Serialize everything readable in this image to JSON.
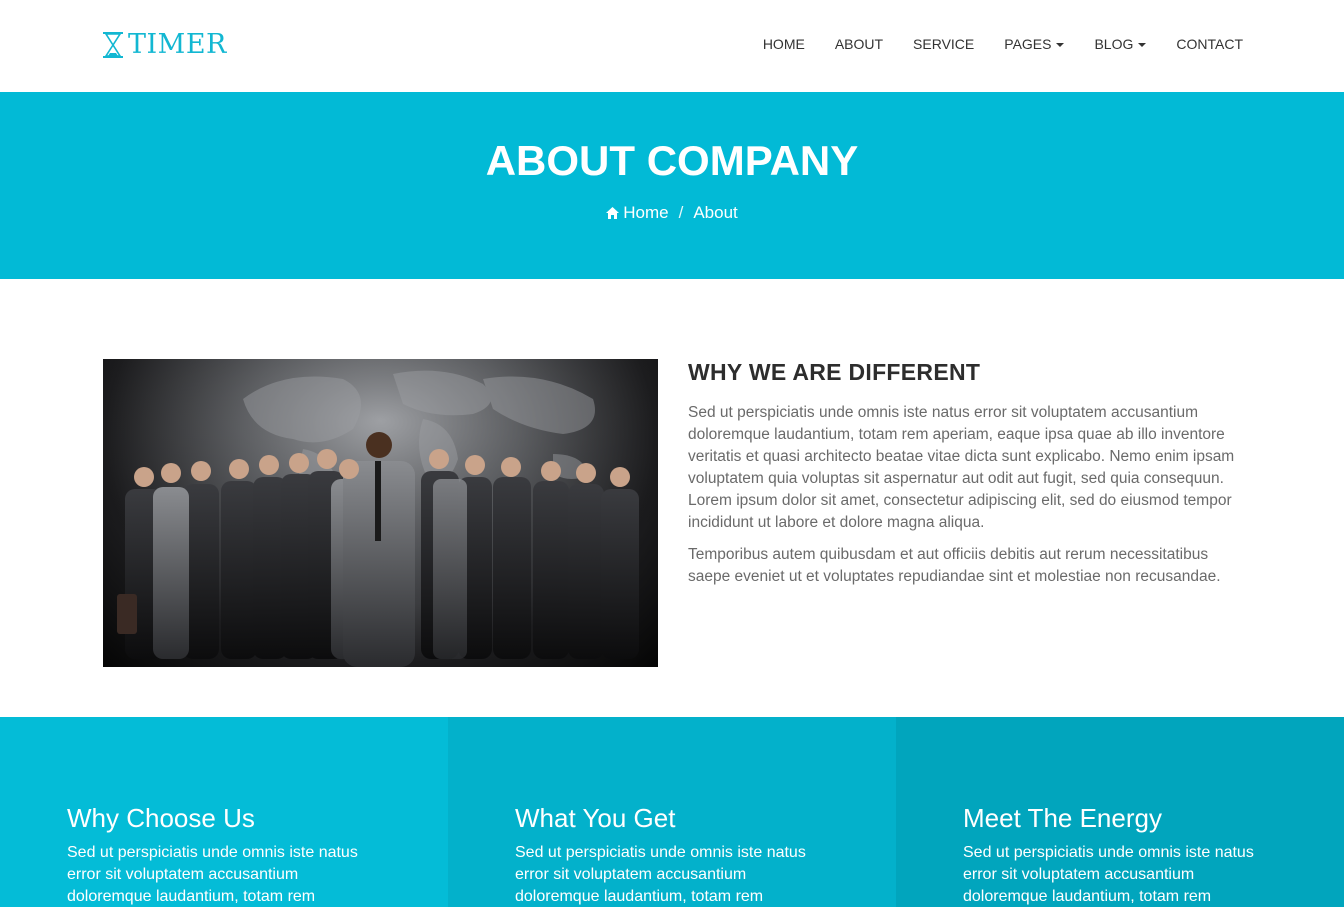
{
  "brand": {
    "name": "TIMER",
    "color": "#12b7d2"
  },
  "nav": {
    "items": [
      {
        "label": "HOME",
        "dropdown": false
      },
      {
        "label": "ABOUT",
        "dropdown": false
      },
      {
        "label": "SERVICE",
        "dropdown": false
      },
      {
        "label": "PAGES",
        "dropdown": true
      },
      {
        "label": "BLOG",
        "dropdown": true
      },
      {
        "label": "CONTACT",
        "dropdown": false
      }
    ]
  },
  "banner": {
    "title": "ABOUT COMPANY",
    "background": "#02bad6",
    "breadcrumb": {
      "home": "Home",
      "separator": "/",
      "current": "About"
    }
  },
  "about": {
    "image_alt": "team-photo",
    "heading": "WHY WE ARE DIFFERENT",
    "paragraph1": "Sed ut perspiciatis unde omnis iste natus error sit voluptatem accusantium doloremque laudantium, totam rem aperiam, eaque ipsa quae ab illo inventore veritatis et quasi architecto beatae vitae dicta sunt explicabo. Nemo enim ipsam voluptatem quia voluptas sit aspernatur aut odit aut fugit, sed quia consequun. Lorem ipsum dolor sit amet, consectetur adipiscing elit, sed do eiusmod tempor incididunt ut labore et dolore magna aliqua.",
    "paragraph2": "Temporibus autem quibusdam et aut officiis debitis aut rerum necessitatibus saepe eveniet ut et voluptates repudiandae sint et molestiae non recusandae."
  },
  "features": [
    {
      "title": "Why Choose Us",
      "text": "Sed ut perspiciatis unde omnis iste natus error sit voluptatem accusantium doloremque laudantium, totam rem",
      "color": "#04bcd7"
    },
    {
      "title": "What You Get",
      "text": "Sed ut perspiciatis unde omnis iste natus error sit voluptatem accusantium doloremque laudantium, totam rem",
      "color": "#03b1cb"
    },
    {
      "title": "Meet The Energy",
      "text": "Sed ut perspiciatis unde omnis iste natus error sit voluptatem accusantium doloremque laudantium, totam rem",
      "color": "#01a5bd"
    }
  ]
}
